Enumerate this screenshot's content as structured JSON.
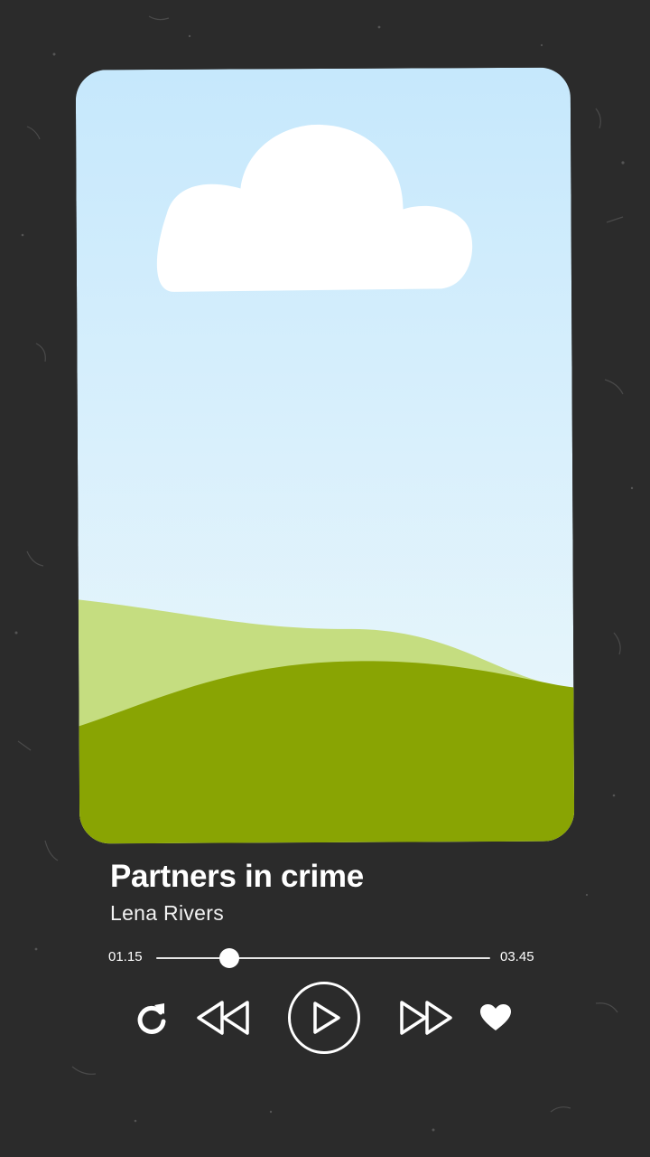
{
  "track": {
    "title": "Partners in crime",
    "artist": "Lena Rivers"
  },
  "progress": {
    "elapsed": "01.15",
    "total": "03.45",
    "fraction": 0.22
  },
  "controls": {
    "repeat_icon": "repeat-icon",
    "rewind_icon": "rewind-icon",
    "play_icon": "play-icon",
    "fast_forward_icon": "fast-forward-icon",
    "favorite_icon": "heart-icon"
  },
  "colors": {
    "background": "#2b2b2b",
    "sky_top": "#c6e8fc",
    "sky_bottom": "#eaf6fb",
    "hill_light": "#c5dd80",
    "hill_dark": "#89a403",
    "foreground": "#ffffff"
  }
}
